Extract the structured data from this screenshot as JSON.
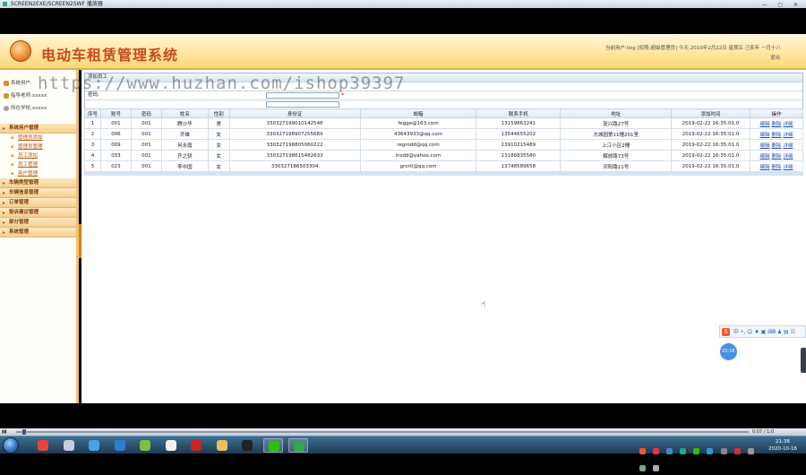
{
  "window": {
    "title": "SCREEN2EXE/SCREEN2SWF 播放器",
    "controls": "— ▢ ✕"
  },
  "app": {
    "system_title": "电动车租赁管理系统",
    "user_info": "当前用户:ilog [权限:超级管理员] 今天:2019年2月22日 星期五 己亥年 一月十八",
    "logout": "退出"
  },
  "sidebar": {
    "info": [
      {
        "label": "系统用户:",
        "icon": "user-icon"
      },
      {
        "label": "指导老师:xxxxx",
        "icon": "teacher-icon"
      },
      {
        "label": "所在学校:xxxxx",
        "icon": "school-icon"
      }
    ],
    "menu": [
      {
        "title": "系统用户管理",
        "items": [
          "管理员添加",
          "管理员管理",
          "员工添加",
          "员工管理",
          "用户管理"
        ]
      },
      {
        "title": "车辆类型管理",
        "items": []
      },
      {
        "title": "车辆信息管理",
        "items": []
      },
      {
        "title": "订单管理",
        "items": []
      },
      {
        "title": "投诉建议管理",
        "items": []
      },
      {
        "title": "部分管理",
        "items": []
      },
      {
        "title": "系统管理",
        "items": []
      }
    ]
  },
  "content": {
    "panel_title": "添加员工",
    "form": [
      {
        "label": "",
        "value": ""
      },
      {
        "label": "密码:",
        "value": "",
        "required": "*"
      },
      {
        "label": "",
        "value": ""
      }
    ],
    "table": {
      "headers": [
        "序号",
        "账号",
        "密码",
        "姓名",
        "性别",
        "身份证",
        "邮箱",
        "联系手机",
        "地址",
        "添加时间",
        "操作"
      ],
      "rows": [
        [
          "1",
          "001",
          "001",
          "腾沙华",
          "男",
          "330327199010142546",
          "fegge@163.com",
          "13159863241",
          "复兴路27号",
          "2019-02-22 16:35:01.0"
        ],
        [
          "2",
          "006",
          "001",
          "齐雄",
          "女",
          "33032719890725568X",
          "43643933@qq.com",
          "13544655202",
          "方城园第11幢201室",
          "2019-02-22 16:35:01.0"
        ],
        [
          "3",
          "009",
          "001",
          "何永霞",
          "女",
          "330327198805060222",
          "regrodd@qq.com",
          "13910215489",
          "上江小区2幢",
          "2019-02-22 16:35:01.0"
        ],
        [
          "4",
          "033",
          "001",
          "齐之骄",
          "女",
          "330327198615482633",
          "trodd@yahoo.com",
          "13186835580",
          "解放路73号",
          "2019-02-22 16:35:01.0"
        ],
        [
          "5",
          "023",
          "001",
          "李中国",
          "女",
          "330327186503304",
          "grorti@qq.com",
          "13748589658",
          "河阳路11号",
          "2019-02-22 16:35:01.0"
        ]
      ],
      "actions": [
        "编辑",
        "删除",
        "详细"
      ]
    }
  },
  "watermark": "https://www.huzhan.com/ishop39397",
  "ime": {
    "logo": "S",
    "label": "中 •, ☺ ♦ ▣ ⌨ ♟ ▤ ☷"
  },
  "recorder": {
    "time": "02:16"
  },
  "player": {
    "time": "0:07 / 1:0"
  },
  "taskbar": {
    "apps": [
      {
        "name": "chrome",
        "color": "#e8453c",
        "active": false
      },
      {
        "name": "media",
        "color": "#c3ccdb",
        "active": false
      },
      {
        "name": "people",
        "color": "#4aa3df",
        "active": false
      },
      {
        "name": "browser",
        "color": "#2f7dd1",
        "active": false
      },
      {
        "name": "app-green",
        "color": "#7bc043",
        "active": false
      },
      {
        "name": "chart",
        "color": "#f0f0f0",
        "active": false
      },
      {
        "name": "flash",
        "color": "#c9251e",
        "active": false
      },
      {
        "name": "folder",
        "color": "#e6c15a",
        "active": false
      },
      {
        "name": "qq",
        "color": "#222",
        "active": false
      },
      {
        "name": "wechat",
        "color": "#2dc100",
        "active": true
      },
      {
        "name": "screen2exe",
        "color": "#2fa84f",
        "active": true
      }
    ],
    "clock_time": "21:38",
    "clock_date": "2020-10-16"
  }
}
